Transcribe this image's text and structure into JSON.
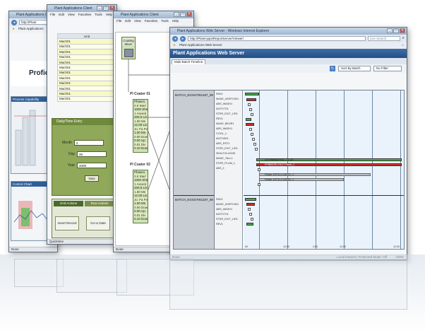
{
  "window1": {
    "title": "Plant Applications Client",
    "address": "http://Plant",
    "tab_label": "Plant Applications",
    "logo_text": "Proficy",
    "panel_top_title": "Process Capability",
    "panel_bottom_title": "Control Chart",
    "status": "Done"
  },
  "window2": {
    "title": "Plant Applications Client",
    "menu": [
      "File",
      "Edit",
      "View",
      "Favorites",
      "Tools",
      "Help"
    ],
    "table_header": "Unit",
    "rows": [
      "Mach01",
      "Mach01",
      "Mach01",
      "Mach01",
      "Mach01",
      "Mach01",
      "Mach01",
      "Mach01",
      "Mach01",
      "Mach01",
      "Mach01",
      "Mach01"
    ],
    "date_entry": {
      "title": "Daily/Time Entry",
      "month_label": "Month",
      "month_value": "2",
      "day_label": "Day",
      "day_value": "26",
      "year_label": "Year",
      "year_value": "2009",
      "now_button": "Now"
    },
    "actions": {
      "tab_grid": "Grid Actions",
      "tab_row": "Row Actions",
      "insert_button": "Insert Record",
      "goto_button": "Go to Date"
    },
    "status_tab": "Quicktime"
  },
  "window3": {
    "title": "Plant Applications Client",
    "menu": [
      "File",
      "Edit",
      "View",
      "Favorites",
      "Tools",
      "Help"
    ],
    "top_node_title": "Coating Mixer",
    "node1_title": "PI Coater 01",
    "node1_lines": [
      "Phase1",
      "0.0 Sterl",
      "1000 Shell",
      "1 Ascent",
      "200.5 Lis",
      "1.00 Mn",
      "12.00 Lis",
      "Jo: Fa Feed",
      "1.00 Mn",
      "0.00 Down",
      "0.00 Up",
      "0.01 Div",
      "0.10 Down"
    ],
    "node2_title": "PI Coater 02",
    "node2_lines": [
      "Phase1",
      "0.0 Sterl",
      "1000 Shell",
      "1 Ascent",
      "200.5 Lis",
      "1.00 Mn",
      "12.00 Lis",
      "Jo: Fa Feed",
      "1.00 Mn",
      "0.00 Down",
      "0.00 Up",
      "0.01 Div",
      "0.10 Down"
    ],
    "status": "Done"
  },
  "window4": {
    "title": "Plant Applications Web Server - Windows Internet Explorer",
    "address": "http://PlantApps/ReportServer/Viewer/",
    "search_placeholder": "Live Search",
    "tab_label": "Plant Applications Web Server",
    "app_title": "Plant Applications Web Server",
    "view_tab_active": "Multi Batch Timeline",
    "sort_label": "Sort By Batch",
    "filter_label": "No Filter",
    "batches": [
      "BATCH_EGSS7W1187_09",
      "BATCH_EGSS7W1187_09"
    ],
    "units": [
      "RK02",
      "MAKE_ASSFV1B1",
      "ABS_WASH1",
      "AGITV701",
      "STER_EXIT_LIR1",
      "REV1",
      "MAKE_BEUR1",
      "ABS_WASH1",
      "COOL_1",
      "AGITV801",
      "ABS_RST1",
      "STER_EXIT_LIR1",
      "SEALTHL4CMS",
      "MAKE_TALL1",
      "STER_PLUM_1",
      "ABS_1",
      "RK02",
      "MAKE_ASSFV1B1",
      "ABS_WASH1",
      "AGITV701",
      "STER_EXIT_LIR1",
      "REV1"
    ],
    "bar_labels": {
      "long_green": "Crr Feeding FB11_T1 LR",
      "long_red": "FPIB/0CR1 FACT Flesh_1",
      "gray1": "Phase 1HT01-CLASS1_1",
      "gray2": "Phase 1HT01-CLASS2_1"
    },
    "axis_ticks": [
      "00",
      "12:00",
      "2:00",
      "12:00",
      "12:00"
    ],
    "status_left": "Done",
    "status_right": "Local intranet | Protected Mode: Off",
    "zoom": "100%"
  },
  "colors": {
    "ie_blue": "#244e84",
    "gantt_green": "#3fb34a",
    "gantt_red": "#cf2f28",
    "olive_panel": "#8fa85a"
  }
}
